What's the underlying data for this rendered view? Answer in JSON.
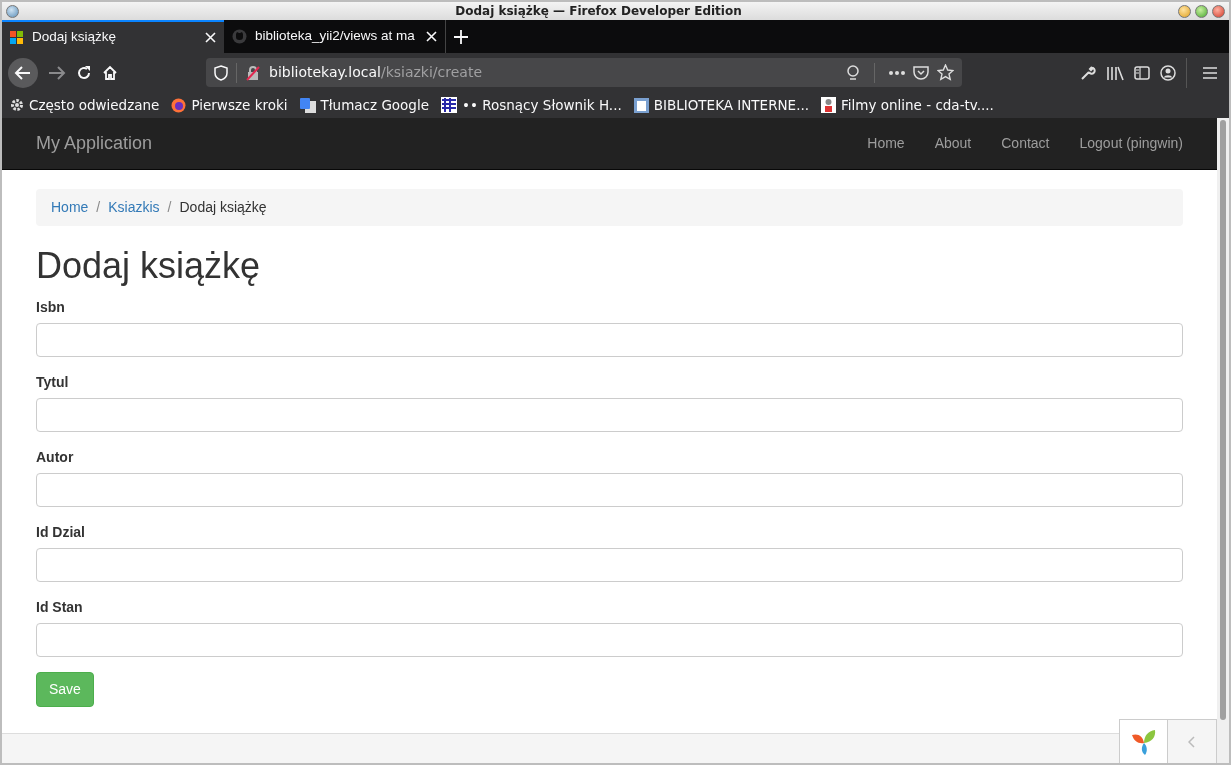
{
  "window": {
    "title": "Dodaj książkę — Firefox Developer Edition"
  },
  "tabs": [
    {
      "label": "Dodaj książkę",
      "selected": true
    },
    {
      "label": "biblioteka_yii2/views at ma",
      "selected": false
    }
  ],
  "address": {
    "host": "bibliotekay.local",
    "path": "/ksiazki/create"
  },
  "bookmarks": [
    {
      "label": "Często odwiedzane"
    },
    {
      "label": "Pierwsze kroki"
    },
    {
      "label": "Tłumacz Google"
    },
    {
      "label": "•• Rosnący Słownik H..."
    },
    {
      "label": "BIBLIOTEKA INTERNE..."
    },
    {
      "label": "Filmy online - cda-tv...."
    }
  ],
  "navbar": {
    "brand": "My Application",
    "items": [
      "Home",
      "About",
      "Contact",
      "Logout (pingwin)"
    ]
  },
  "breadcrumb": [
    {
      "label": "Home",
      "link": true
    },
    {
      "label": "/",
      "kind": "separator"
    },
    {
      "label": "Ksiazkis",
      "link": true
    },
    {
      "label": "/",
      "kind": "separator"
    },
    {
      "label": "Dodaj książkę",
      "link": false
    }
  ],
  "heading": "Dodaj książkę",
  "fields": [
    {
      "label": "Isbn"
    },
    {
      "label": "Tytul"
    },
    {
      "label": "Autor"
    },
    {
      "label": "Id Dzial"
    },
    {
      "label": "Id Stan"
    }
  ],
  "save_button": "Save"
}
